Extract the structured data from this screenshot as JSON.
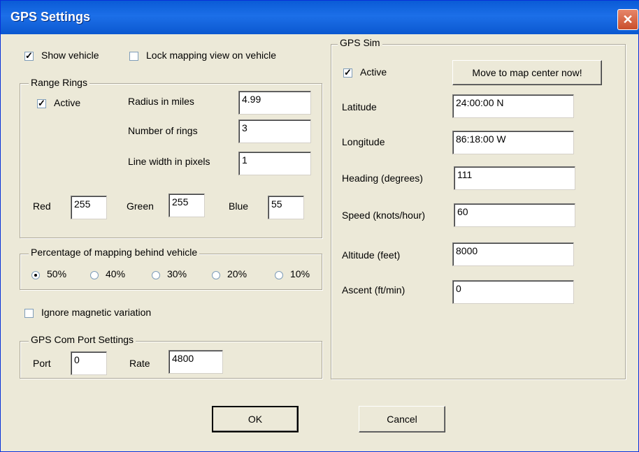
{
  "window": {
    "title": "GPS Settings",
    "close_glyph": "✕"
  },
  "left": {
    "show_vehicle": {
      "label": "Show vehicle",
      "checked": true
    },
    "lock_view": {
      "label": "Lock mapping view on vehicle",
      "checked": false
    },
    "range_rings": {
      "legend": "Range Rings",
      "active": {
        "label": "Active",
        "checked": true
      },
      "radius_label": "Radius in miles",
      "radius_value": "4.99",
      "rings_label": "Number of rings",
      "rings_value": "3",
      "width_label": "Line width in pixels",
      "width_value": "1",
      "red_label": "Red",
      "red_value": "255",
      "green_label": "Green",
      "green_value": "255",
      "blue_label": "Blue",
      "blue_value": "55"
    },
    "percentage": {
      "legend": "Percentage of mapping behind vehicle",
      "options": [
        "50%",
        "40%",
        "30%",
        "20%",
        "10%"
      ],
      "selected": "50%"
    },
    "ignore_magnetic": {
      "label": "Ignore magnetic variation",
      "checked": false
    },
    "com_port": {
      "legend": "GPS Com Port Settings",
      "port_label": "Port",
      "port_value": "0",
      "rate_label": "Rate",
      "rate_value": "4800"
    }
  },
  "sim": {
    "legend": "GPS Sim",
    "active": {
      "label": "Active",
      "checked": true
    },
    "move_button": "Move to map center now!",
    "latitude_label": "Latitude",
    "latitude_value": "24:00:00 N",
    "longitude_label": "Longitude",
    "longitude_value": "86:18:00 W",
    "heading_label": "Heading (degrees)",
    "heading_value": "111",
    "speed_label": "Speed (knots/hour)",
    "speed_value": "60",
    "altitude_label": "Altitude (feet)",
    "altitude_value": "8000",
    "ascent_label": "Ascent (ft/min)",
    "ascent_value": "0"
  },
  "buttons": {
    "ok": "OK",
    "cancel": "Cancel"
  }
}
